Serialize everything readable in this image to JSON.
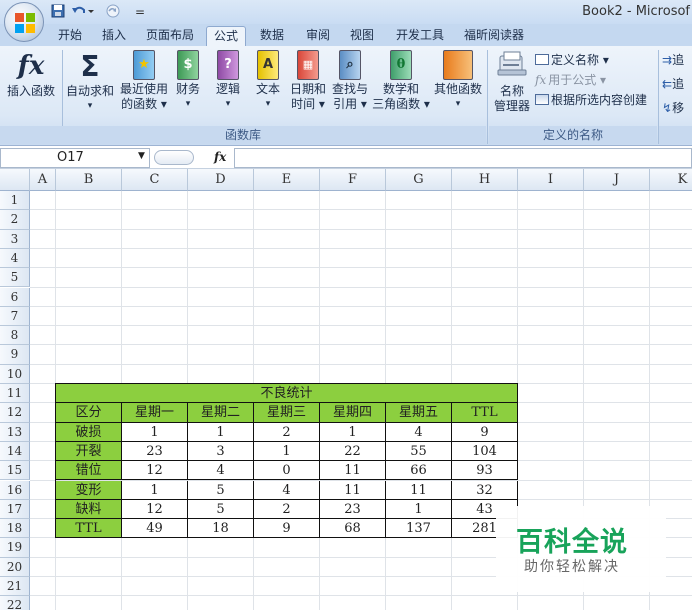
{
  "window": {
    "title": "Book2 - Microsof"
  },
  "quick_access": {
    "save_icon": "save-icon",
    "undo_icon": "undo-icon",
    "redo_icon": "redo-icon",
    "customize": "="
  },
  "tabs": [
    {
      "label": "开始"
    },
    {
      "label": "插入"
    },
    {
      "label": "页面布局"
    },
    {
      "label": "公式",
      "active": true
    },
    {
      "label": "数据"
    },
    {
      "label": "审阅"
    },
    {
      "label": "视图"
    },
    {
      "label": "开发工具"
    },
    {
      "label": "福昕阅读器"
    }
  ],
  "ribbon": {
    "function_library": {
      "label": "函数库",
      "insert_function": "插入函数",
      "autosum_1": "自动求和",
      "autosum_2": "▾",
      "recent_1": "最近使用",
      "recent_2": "的函数 ▾",
      "financial_1": "财务",
      "financial_2": "▾",
      "logical_1": "逻辑",
      "logical_2": "▾",
      "text_1": "文本",
      "text_2": "▾",
      "datetime_1": "日期和",
      "datetime_2": "时间 ▾",
      "lookup_1": "查找与",
      "lookup_2": "引用 ▾",
      "math_1": "数学和",
      "math_2": "三角函数 ▾",
      "more_1": "其他函数",
      "more_2": "▾"
    },
    "defined_names": {
      "label": "定义的名称",
      "name_manager_1": "名称",
      "name_manager_2": "管理器",
      "define_name": "定义名称 ▾",
      "use_in_formula": "用于公式 ▾",
      "create_from_selection": "根据所选内容创建"
    },
    "formula_auditing": {
      "trace_precedents": "追",
      "trace_dependents": "追",
      "remove_arrows": "移"
    }
  },
  "formula_bar": {
    "name_box": "O17",
    "fx_label": "fx",
    "formula": ""
  },
  "sheet": {
    "columns": [
      "A",
      "B",
      "C",
      "D",
      "E",
      "F",
      "G",
      "H",
      "I",
      "J",
      "K"
    ],
    "rows": [
      "1",
      "2",
      "3",
      "4",
      "5",
      "6",
      "7",
      "8",
      "9",
      "10",
      "11",
      "12",
      "13",
      "14",
      "15",
      "16",
      "17",
      "18",
      "19",
      "20",
      "21",
      "22"
    ],
    "table_title": "不良统计",
    "table_header": [
      "区分",
      "星期一",
      "星期二",
      "星期三",
      "星期四",
      "星期五",
      "TTL"
    ],
    "table_rows": [
      [
        "破损",
        "1",
        "1",
        "2",
        "1",
        "4",
        "9"
      ],
      [
        "开裂",
        "23",
        "3",
        "1",
        "22",
        "55",
        "104"
      ],
      [
        "错位",
        "12",
        "4",
        "0",
        "11",
        "66",
        "93"
      ],
      [
        "变形",
        "1",
        "5",
        "4",
        "11",
        "11",
        "32"
      ],
      [
        "缺料",
        "12",
        "5",
        "2",
        "23",
        "1",
        "43"
      ],
      [
        "TTL",
        "49",
        "18",
        "9",
        "68",
        "137",
        "281"
      ]
    ]
  },
  "watermark": {
    "title": "百科全说",
    "subtitle": "助你轻松解决"
  }
}
